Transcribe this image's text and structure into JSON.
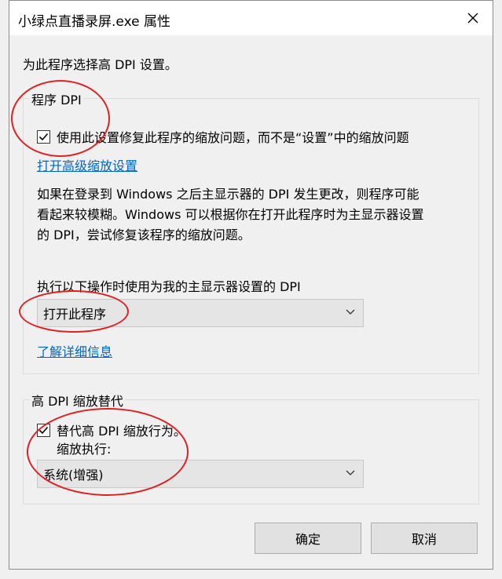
{
  "window": {
    "title": "小绿点直播录屏.exe 属性",
    "close_glyph": "✕"
  },
  "intro": "为此程序选择高 DPI 设置。",
  "program_dpi": {
    "legend": "程序 DPI",
    "checkbox_label": "使用此设置修复此程序的缩放问题，而不是“设置”中的缩放问题",
    "checked": true,
    "advanced_link": "打开高级缩放设置",
    "description_lines": [
      "如果在登录到 Windows 之后主显示器的 DPI 发生更改，则程序可能",
      "看起来较模糊。Windows 可以根据你在打开此程序时为主显示器设置",
      "的 DPI，尝试修复该程序的缩放问题。"
    ],
    "select_label": "执行以下操作时使用为我的主显示器设置的 DPI",
    "select_value": "打开此程序",
    "learn_more_link": "了解详细信息"
  },
  "override": {
    "legend": "高 DPI 缩放替代",
    "checkbox_label": "替代高 DPI 缩放行为。",
    "checked": true,
    "sub_label": "缩放执行:",
    "select_value": "系统(增强)"
  },
  "buttons": {
    "ok": "确定",
    "cancel": "取消"
  },
  "colors": {
    "link": "#0066cc",
    "annotation": "#e02020"
  }
}
